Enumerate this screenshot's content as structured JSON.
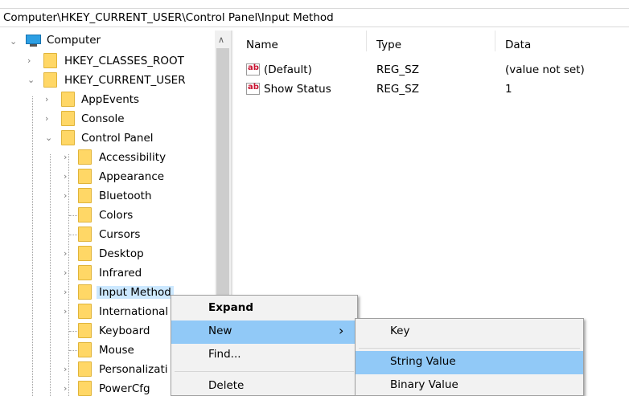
{
  "address_bar": {
    "path": "Computer\\HKEY_CURRENT_USER\\Control Panel\\Input Method"
  },
  "tree": {
    "root": {
      "label": "Computer",
      "icon": "computer-icon"
    },
    "hives": [
      {
        "label": "HKEY_CLASSES_ROOT",
        "expanded": false
      },
      {
        "label": "HKEY_CURRENT_USER",
        "expanded": true
      }
    ],
    "hkcu_children": [
      {
        "label": "AppEvents"
      },
      {
        "label": "Console"
      },
      {
        "label": "Control Panel",
        "expanded": true
      }
    ],
    "control_panel_children": [
      {
        "label": "Accessibility",
        "expander": true
      },
      {
        "label": "Appearance",
        "expander": true
      },
      {
        "label": "Bluetooth",
        "expander": true
      },
      {
        "label": "Colors",
        "expander": false
      },
      {
        "label": "Cursors",
        "expander": false
      },
      {
        "label": "Desktop",
        "expander": true
      },
      {
        "label": "Infrared",
        "expander": true
      },
      {
        "label": "Input Method",
        "expander": true,
        "selected": true
      },
      {
        "label": "International",
        "expander": true
      },
      {
        "label": "Keyboard",
        "expander": false
      },
      {
        "label": "Mouse",
        "expander": false
      },
      {
        "label": "Personalizati",
        "expander": true
      },
      {
        "label": "PowerCfg",
        "expander": true
      }
    ]
  },
  "values_pane": {
    "columns": {
      "name": "Name",
      "type": "Type",
      "data": "Data"
    },
    "rows": [
      {
        "name": "(Default)",
        "type": "REG_SZ",
        "data": "(value not set)",
        "icon": "string-value-icon"
      },
      {
        "name": "Show Status",
        "type": "REG_SZ",
        "data": "1",
        "icon": "string-value-icon"
      }
    ]
  },
  "context_menu": {
    "expand": "Expand",
    "new": "New",
    "find": "Find...",
    "delete": "Delete",
    "submenu_arrow": "›"
  },
  "new_submenu": {
    "key": "Key",
    "string_value": "String Value",
    "binary_value": "Binary Value"
  },
  "colors": {
    "selection": "#cce8ff",
    "menu_highlight": "#91c9f7",
    "folder": "#ffd766"
  }
}
